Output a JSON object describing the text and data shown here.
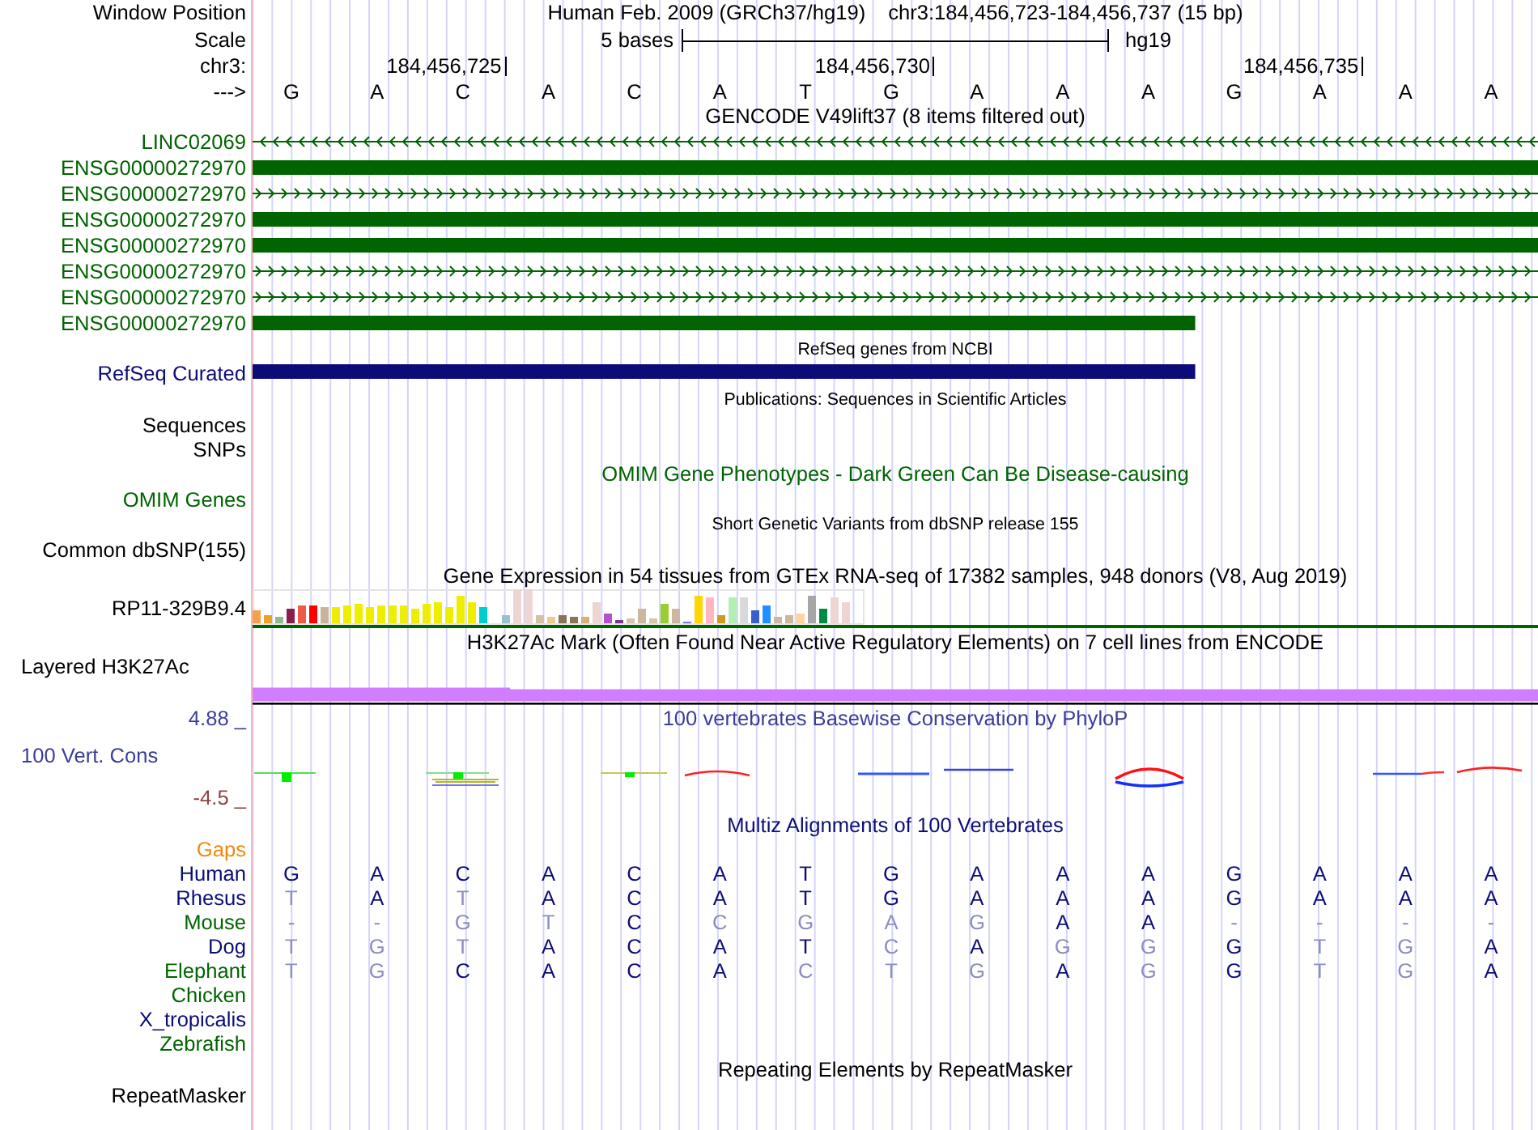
{
  "header": {
    "window_position_label": "Window Position",
    "assembly_title": "Human Feb. 2009 (GRCh37/hg19)",
    "position": "chr3:184,456,723-184,456,737 (15 bp)",
    "scale_label": "Scale",
    "scale_text": "5 bases",
    "scale_assembly": "hg19",
    "chrom_label": "chr3:",
    "ticks": [
      "184,456,725",
      "184,456,730",
      "184,456,735"
    ],
    "strand_label": "--->",
    "bases": [
      "G",
      "A",
      "C",
      "A",
      "C",
      "A",
      "T",
      "G",
      "A",
      "A",
      "A",
      "G",
      "A",
      "A",
      "A"
    ]
  },
  "tracks": [
    {
      "kind": "genes",
      "title": "GENCODE V49lift37 (8 items filtered out)",
      "color": "#006400",
      "items": [
        {
          "name": "LINC02069",
          "kind": "reverse",
          "ends_in_view": false
        },
        {
          "name": "ENSG00000272970",
          "kind": "block",
          "ends_in_view": false
        },
        {
          "name": "ENSG00000272970",
          "kind": "forward",
          "ends_in_view": false
        },
        {
          "name": "ENSG00000272970",
          "kind": "block",
          "ends_in_view": false
        },
        {
          "name": "ENSG00000272970",
          "kind": "block",
          "ends_in_view": false
        },
        {
          "name": "ENSG00000272970",
          "kind": "forward",
          "ends_in_view": false
        },
        {
          "name": "ENSG00000272970",
          "kind": "forward",
          "ends_in_view": false
        },
        {
          "name": "ENSG00000272970",
          "kind": "block",
          "ends_in_view": true
        }
      ]
    },
    {
      "kind": "refseq",
      "title": "RefSeq genes from NCBI",
      "color": "#0c0c78",
      "items": [
        {
          "name": "RefSeq Curated",
          "kind": "block",
          "ends_in_view": true
        }
      ]
    },
    {
      "kind": "publications",
      "title": "Publications: Sequences in Scientific Articles",
      "labels": [
        "Sequences",
        "SNPs"
      ]
    },
    {
      "kind": "omim",
      "title": "OMIM Gene Phenotypes - Dark Green Can Be Disease-causing",
      "color": "#006400",
      "labels": [
        "OMIM Genes"
      ]
    },
    {
      "kind": "snps",
      "title": "Short Genetic Variants from dbSNP release 155",
      "labels": [
        "Common dbSNP(155)"
      ]
    },
    {
      "kind": "expression",
      "title": "Gene Expression in 54 tissues from GTEx RNA-seq of 17382 samples, 948 donors (V8, Aug 2019)",
      "label": "RP11-329B9.4",
      "color": "#006400"
    },
    {
      "kind": "layered",
      "title": "H3K27Ac Mark (Often Found Near Active Regulatory Elements) on 7 cell lines from ENCODE",
      "label": "Layered H3K27Ac"
    },
    {
      "kind": "conservation",
      "title": "100 vertebrates Basewise Conservation by PhyloP",
      "label": "100 Vert. Cons",
      "color": "#3c3c99",
      "scale": [
        {
          "text": "4.88 _",
          "color": "#3c3c99"
        },
        {
          "text": "-4.5 _",
          "color": "#8c4444"
        }
      ]
    },
    {
      "kind": "alignment",
      "title": "Multiz Alignments of 100 Vertebrates",
      "color": "#0c0c78",
      "rows": [
        {
          "label": "Gaps",
          "kind": "gaps",
          "color": "#ef8a10"
        },
        {
          "label": "Human",
          "kind": "species",
          "color": "#0c0c78",
          "bases": [
            {
              "base": "G",
              "match": true
            },
            {
              "base": "A",
              "match": true
            },
            {
              "base": "C",
              "match": true
            },
            {
              "base": "A",
              "match": true
            },
            {
              "base": "C",
              "match": true
            },
            {
              "base": "A",
              "match": true
            },
            {
              "base": "T",
              "match": true
            },
            {
              "base": "G",
              "match": true
            },
            {
              "base": "A",
              "match": true
            },
            {
              "base": "A",
              "match": true
            },
            {
              "base": "A",
              "match": true
            },
            {
              "base": "G",
              "match": true
            },
            {
              "base": "A",
              "match": true
            },
            {
              "base": "A",
              "match": true
            },
            {
              "base": "A",
              "match": true
            }
          ]
        },
        {
          "label": "Rhesus",
          "kind": "species",
          "color": "#0c0c78",
          "bases": [
            {
              "base": "T",
              "match": false
            },
            {
              "base": "A",
              "match": true
            },
            {
              "base": "T",
              "match": false
            },
            {
              "base": "A",
              "match": true
            },
            {
              "base": "C",
              "match": true
            },
            {
              "base": "A",
              "match": true
            },
            {
              "base": "T",
              "match": true
            },
            {
              "base": "G",
              "match": true
            },
            {
              "base": "A",
              "match": true
            },
            {
              "base": "A",
              "match": true
            },
            {
              "base": "A",
              "match": true
            },
            {
              "base": "G",
              "match": true
            },
            {
              "base": "A",
              "match": true
            },
            {
              "base": "A",
              "match": true
            },
            {
              "base": "A",
              "match": true
            }
          ]
        },
        {
          "label": "Mouse",
          "kind": "species",
          "color": "#006400",
          "bases": [
            {
              "base": "-",
              "match": false
            },
            {
              "base": "-",
              "match": false
            },
            {
              "base": "G",
              "match": false
            },
            {
              "base": "T",
              "match": false
            },
            {
              "base": "C",
              "match": true
            },
            {
              "base": "C",
              "match": false
            },
            {
              "base": "G",
              "match": false
            },
            {
              "base": "A",
              "match": false
            },
            {
              "base": "G",
              "match": false
            },
            {
              "base": "A",
              "match": true
            },
            {
              "base": "A",
              "match": true
            },
            {
              "base": "-",
              "match": false
            },
            {
              "base": "-",
              "match": false
            },
            {
              "base": "-",
              "match": false
            },
            {
              "base": "-",
              "match": false
            }
          ]
        },
        {
          "label": "Dog",
          "kind": "species",
          "color": "#0c0c78",
          "bases": [
            {
              "base": "T",
              "match": false
            },
            {
              "base": "G",
              "match": false
            },
            {
              "base": "T",
              "match": false
            },
            {
              "base": "A",
              "match": true
            },
            {
              "base": "C",
              "match": true
            },
            {
              "base": "A",
              "match": true
            },
            {
              "base": "T",
              "match": true
            },
            {
              "base": "C",
              "match": false
            },
            {
              "base": "A",
              "match": true
            },
            {
              "base": "G",
              "match": false
            },
            {
              "base": "G",
              "match": false
            },
            {
              "base": "G",
              "match": true
            },
            {
              "base": "T",
              "match": false
            },
            {
              "base": "G",
              "match": false
            },
            {
              "base": "A",
              "match": true
            }
          ]
        },
        {
          "label": "Elephant",
          "kind": "species",
          "color": "#006400",
          "bases": [
            {
              "base": "T",
              "match": false
            },
            {
              "base": "G",
              "match": false
            },
            {
              "base": "C",
              "match": true
            },
            {
              "base": "A",
              "match": true
            },
            {
              "base": "C",
              "match": true
            },
            {
              "base": "A",
              "match": true
            },
            {
              "base": "C",
              "match": false
            },
            {
              "base": "T",
              "match": false
            },
            {
              "base": "G",
              "match": false
            },
            {
              "base": "A",
              "match": true
            },
            {
              "base": "G",
              "match": false
            },
            {
              "base": "G",
              "match": true
            },
            {
              "base": "T",
              "match": false
            },
            {
              "base": "G",
              "match": false
            },
            {
              "base": "A",
              "match": true
            }
          ]
        },
        {
          "label": "Chicken",
          "kind": "species",
          "color": "#006400"
        },
        {
          "label": "X_tropicalis",
          "kind": "species",
          "color": "#0c0c78"
        },
        {
          "label": "Zebrafish",
          "kind": "species",
          "color": "#006400"
        }
      ]
    },
    {
      "kind": "repeats",
      "title": "Repeating Elements by RepeatMasker",
      "labels": [
        "RepeatMasker"
      ]
    }
  ]
}
